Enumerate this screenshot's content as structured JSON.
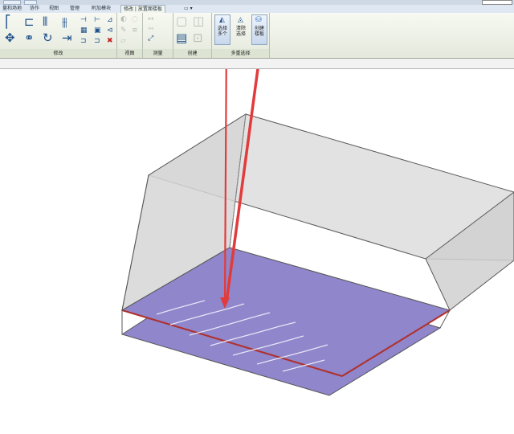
{
  "tabs": [
    {
      "label": "量和场地"
    },
    {
      "label": "协作"
    },
    {
      "label": "视图"
    },
    {
      "label": "管理"
    },
    {
      "label": "附加模块"
    },
    {
      "label": "修改 | 放置面楼板"
    },
    {
      "label": "▭ ▾"
    }
  ],
  "panels": {
    "modify": "修改",
    "view": "视图",
    "measure": "测量",
    "create": "创建",
    "multi_select": "多重选择"
  },
  "buttons": {
    "select_multiple": "选择\n多个",
    "clear_selection": "清除\n选择",
    "create_floor": "创建\n楼板"
  },
  "colors": {
    "floor_fill": "#8f86cb",
    "floor_edge": "#b0302a",
    "arrow": "#e23b3b",
    "mass_fill": "#dcdcdc",
    "mass_edge": "#5a5a5a"
  }
}
